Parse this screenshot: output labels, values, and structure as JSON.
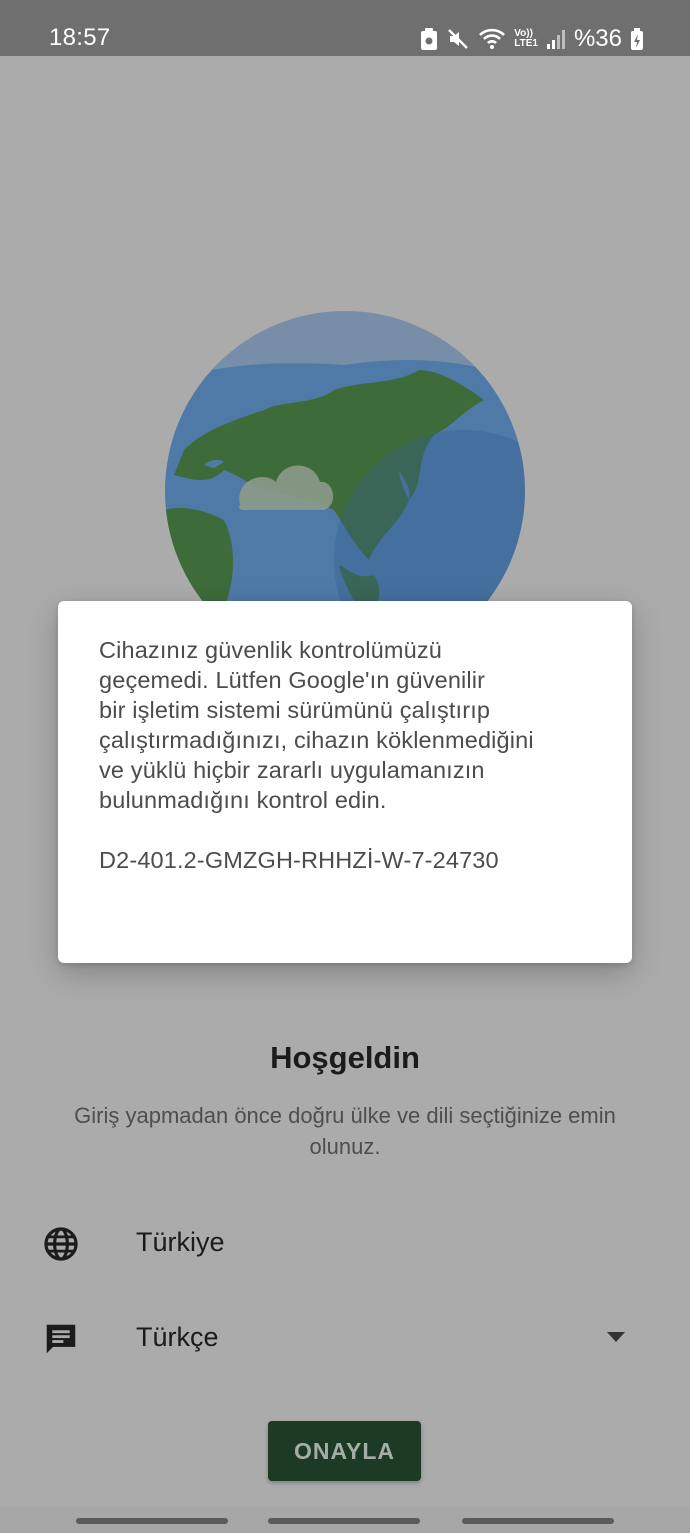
{
  "status_bar": {
    "time": "18:57",
    "battery": "%36",
    "network_label_top": "Vo))",
    "network_label_bottom": "LTE1",
    "icons": [
      "screenshot-icon",
      "mute-icon",
      "wifi-icon",
      "lte-icon",
      "signal-icon",
      "battery-icon"
    ]
  },
  "dialog": {
    "message": "Cihazınız güvenlik kontrolümüzü\ngeçemedi. Lütfen Google'ın güvenilir\nbir işletim sistemi sürümünü çalıştırıp\nçalıştırmadığınızı, cihazın köklenmediğini\nve yüklü hiçbir zararlı uygulamanızın\nbulunmadığını kontrol edin.",
    "code": "D2-401.2-GMZGH-RHHZİ-W-7-24730"
  },
  "welcome": {
    "title": "Hoşgeldin",
    "subtitle": "Giriş yapmadan önce doğru ülke ve dili seçtiğinize emin olunuz."
  },
  "country": {
    "label": "Türkiye",
    "icon": "globe-icon"
  },
  "language": {
    "label": "Türkçe",
    "icon": "message-icon"
  },
  "confirm_button": {
    "label": "ONAYLA"
  },
  "colors": {
    "overlay_background": "#ababab",
    "button": "#1c3a24",
    "globe_ocean": "#4f79a6",
    "globe_land": "#3e6b3a"
  }
}
